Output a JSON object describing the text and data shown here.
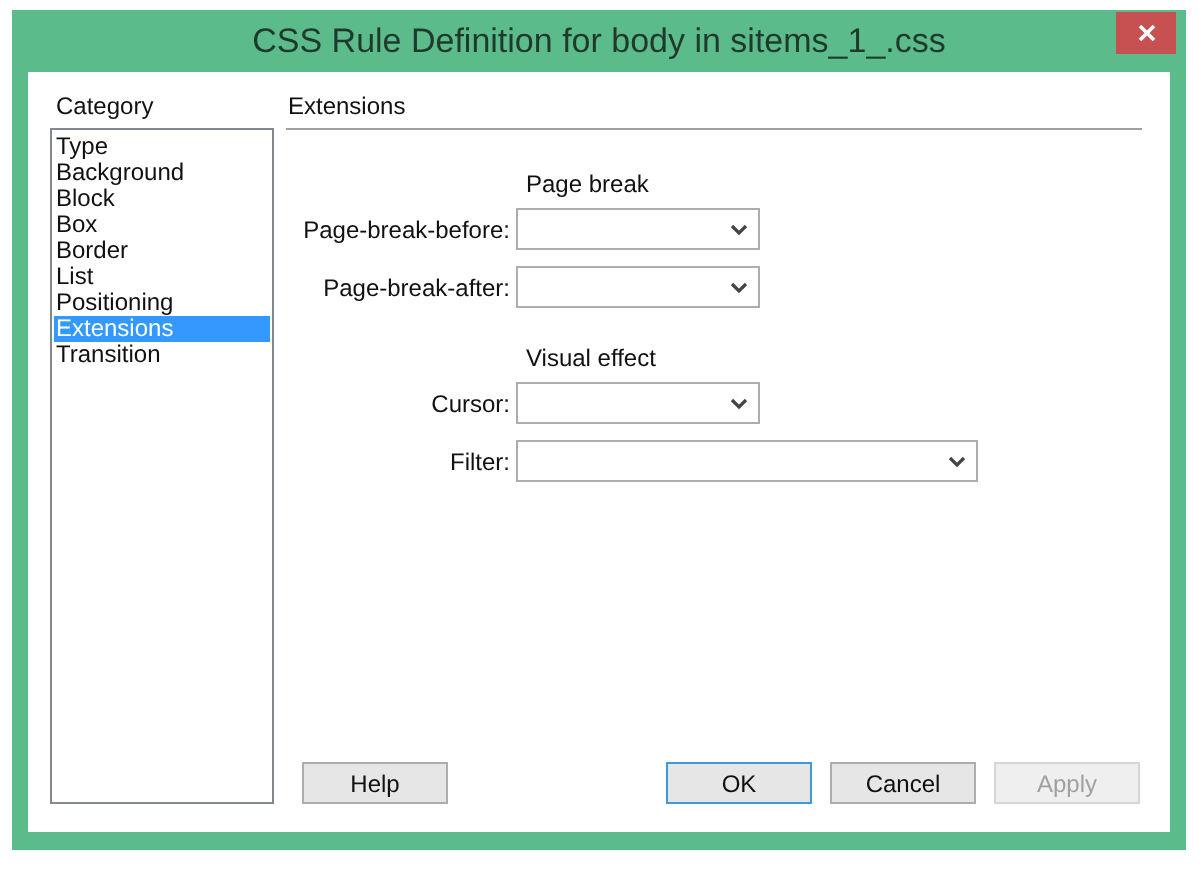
{
  "window": {
    "title": "CSS Rule Definition for body in sitems_1_.css"
  },
  "category": {
    "label": "Category",
    "items": [
      {
        "label": "Type",
        "selected": false
      },
      {
        "label": "Background",
        "selected": false
      },
      {
        "label": "Block",
        "selected": false
      },
      {
        "label": "Box",
        "selected": false
      },
      {
        "label": "Border",
        "selected": false
      },
      {
        "label": "List",
        "selected": false
      },
      {
        "label": "Positioning",
        "selected": false
      },
      {
        "label": "Extensions",
        "selected": true
      },
      {
        "label": "Transition",
        "selected": false
      }
    ]
  },
  "panel": {
    "title": "Extensions",
    "groups": [
      {
        "heading": "Page break",
        "fields": [
          {
            "label": "Page-break-before:"
          },
          {
            "label": "Page-break-after:"
          }
        ]
      },
      {
        "heading": "Visual effect",
        "fields": [
          {
            "label": "Cursor:"
          },
          {
            "label": "Filter:"
          }
        ]
      }
    ]
  },
  "buttons": [
    {
      "label": "Help",
      "default": false,
      "disabled": false
    },
    {
      "label": "OK",
      "default": true,
      "disabled": false
    },
    {
      "label": "Cancel",
      "default": false,
      "disabled": false
    },
    {
      "label": "Apply",
      "default": false,
      "disabled": true
    }
  ]
}
